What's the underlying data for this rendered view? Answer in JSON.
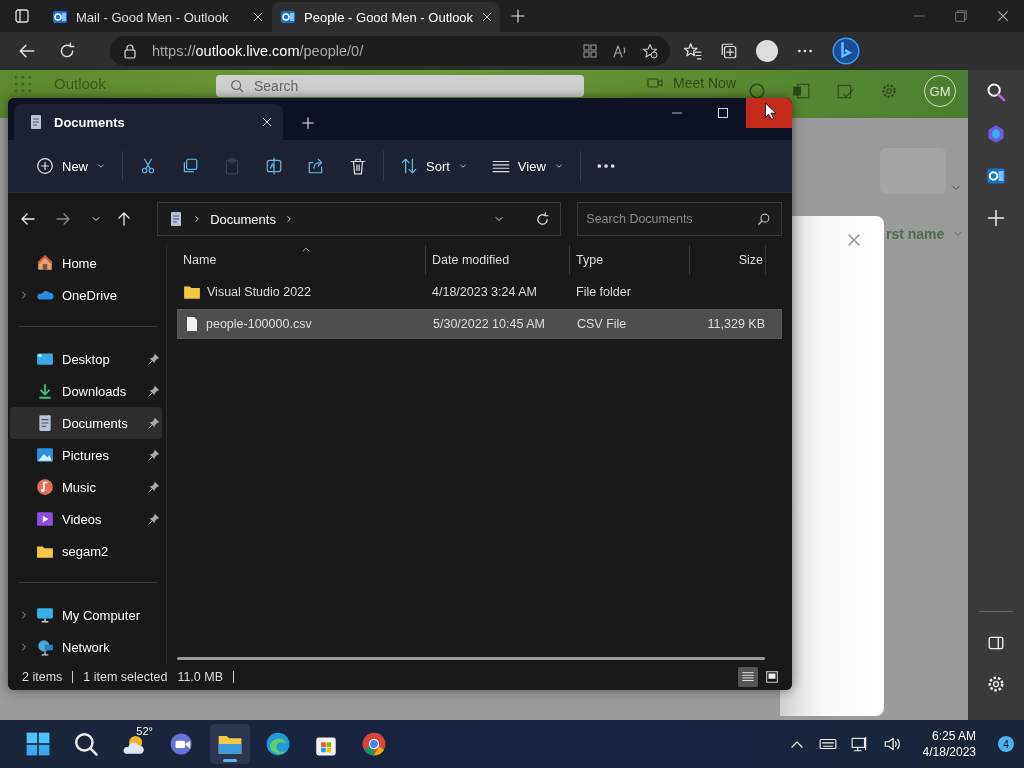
{
  "browser": {
    "tabs": [
      {
        "title": "Mail - Good Men - Outlook",
        "selected": false
      },
      {
        "title": "People - Good Men - Outlook",
        "selected": true
      }
    ],
    "url": {
      "scheme": "https://",
      "host": "outlook.live.com",
      "path": "/people/0/"
    }
  },
  "outlook": {
    "app_name": "Outlook",
    "search_placeholder": "Search",
    "meet_now": "Meet Now",
    "avatar": "GM",
    "sort_label": "rst name"
  },
  "explorer": {
    "tab": "Documents",
    "toolbar": [
      [
        {
          "kind": "new",
          "label": "New",
          "disabled": false
        }
      ],
      [
        {
          "kind": "cut",
          "disabled": false
        },
        {
          "kind": "copy",
          "disabled": false
        },
        {
          "kind": "paste",
          "disabled": true
        },
        {
          "kind": "rename",
          "disabled": false
        },
        {
          "kind": "share",
          "disabled": false
        },
        {
          "kind": "delete",
          "disabled": false
        }
      ],
      [
        {
          "kind": "sort",
          "label": "Sort",
          "disabled": false
        },
        {
          "kind": "view",
          "label": "View",
          "disabled": false
        }
      ],
      [
        {
          "kind": "more",
          "disabled": false
        }
      ]
    ],
    "breadcrumb": [
      "Documents"
    ],
    "search_placeholder": "Search Documents",
    "nav_groups": [
      [
        {
          "label": "Home",
          "kind": "home",
          "expandable": false,
          "pinned": false,
          "selected": false
        },
        {
          "label": "OneDrive",
          "kind": "onedrive",
          "expandable": true,
          "pinned": false,
          "selected": false
        }
      ],
      [
        {
          "label": "Desktop",
          "kind": "desktop",
          "expandable": false,
          "pinned": true,
          "selected": false
        },
        {
          "label": "Downloads",
          "kind": "downloads",
          "expandable": false,
          "pinned": true,
          "selected": false
        },
        {
          "label": "Documents",
          "kind": "documents",
          "expandable": false,
          "pinned": true,
          "selected": true
        },
        {
          "label": "Pictures",
          "kind": "pictures",
          "expandable": false,
          "pinned": true,
          "selected": false
        },
        {
          "label": "Music",
          "kind": "music",
          "expandable": false,
          "pinned": true,
          "selected": false
        },
        {
          "label": "Videos",
          "kind": "videos",
          "expandable": false,
          "pinned": true,
          "selected": false
        },
        {
          "label": "segam2",
          "kind": "folder",
          "expandable": false,
          "pinned": false,
          "selected": false
        }
      ],
      [
        {
          "label": "My Computer",
          "kind": "computer",
          "expandable": true,
          "pinned": false,
          "selected": false
        },
        {
          "label": "Network",
          "kind": "network",
          "expandable": true,
          "pinned": false,
          "selected": false
        }
      ]
    ],
    "columns": [
      "Name",
      "Date modified",
      "Type",
      "Size"
    ],
    "rows": [
      {
        "kind": "folder",
        "name": "Visual Studio 2022",
        "date": "4/18/2023 3:24 AM",
        "type": "File folder",
        "selected": false
      },
      {
        "kind": "file",
        "name": "people-100000.csv",
        "date": "5/30/2022 10:45 AM",
        "type": "CSV File",
        "size": "11,329 KB",
        "selected": true
      }
    ],
    "status": {
      "items": "2 items",
      "selection": "1 item selected",
      "size": "11.0 MB"
    }
  },
  "dialog": {
    "kind": "panel"
  },
  "taskbar": {
    "apps": [
      {
        "kind": "start",
        "selected": false
      },
      {
        "kind": "search",
        "selected": false
      },
      {
        "kind": "weather",
        "badge": "52°",
        "selected": false
      },
      {
        "kind": "meet",
        "selected": false
      },
      {
        "kind": "explorer",
        "selected": true
      },
      {
        "kind": "edge",
        "selected": false
      },
      {
        "kind": "store",
        "selected": false
      },
      {
        "kind": "chrome",
        "selected": false
      }
    ],
    "time": "6:25 AM",
    "date": "4/18/2023",
    "notifications": "4"
  }
}
